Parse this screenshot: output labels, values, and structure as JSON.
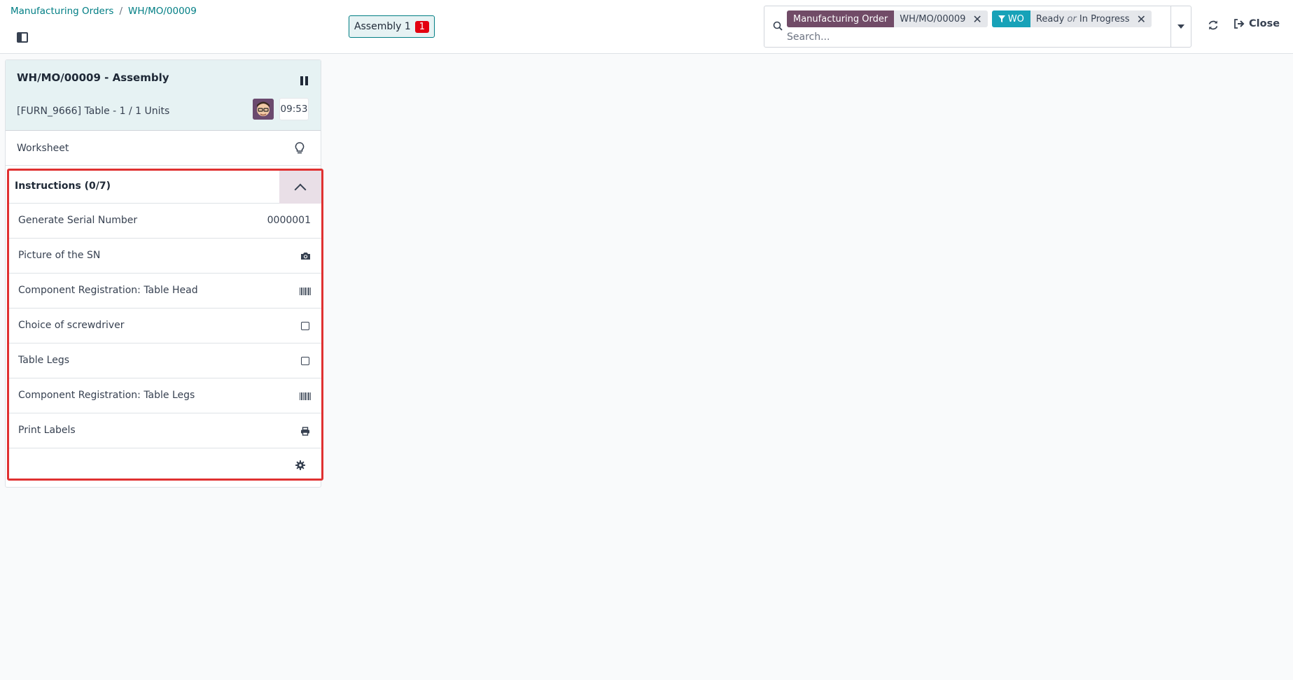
{
  "breadcrumb": {
    "parent": "Manufacturing Orders",
    "separator": "/",
    "current": "WH/MO/00009"
  },
  "workcenter": {
    "label": "Assembly 1",
    "badge": "1"
  },
  "search": {
    "facets": [
      {
        "label": "Manufacturing Order",
        "color": "#714b67",
        "value": "WH/MO/00009"
      },
      {
        "label": "WO",
        "color": "#17a2b8",
        "value_a": "Ready",
        "connector": "or",
        "value_b": "In Progress"
      }
    ],
    "placeholder": "Search..."
  },
  "header_actions": {
    "close_label": "Close"
  },
  "card": {
    "title": "WH/MO/00009 - Assembly",
    "product": "[FURN_9666] Table - 1 / 1 Units",
    "timer": "09:53",
    "worksheet_label": "Worksheet",
    "instructions_label": "Instructions (0/7)",
    "steps": [
      {
        "label": "Generate Serial Number",
        "value": "0000001"
      },
      {
        "label": "Picture of the SN",
        "icon": "camera-icon"
      },
      {
        "label": "Component Registration: Table Head",
        "icon": "barcode-icon"
      },
      {
        "label": "Choice of screwdriver",
        "icon": "checkbox-icon"
      },
      {
        "label": "Table Legs",
        "icon": "checkbox-icon"
      },
      {
        "label": "Component Registration: Table Legs",
        "icon": "barcode-icon"
      },
      {
        "label": "Print Labels",
        "icon": "print-icon"
      }
    ]
  },
  "colors": {
    "accent": "#017e84",
    "highlight_border": "#e03131",
    "badge": "#e3000f"
  }
}
